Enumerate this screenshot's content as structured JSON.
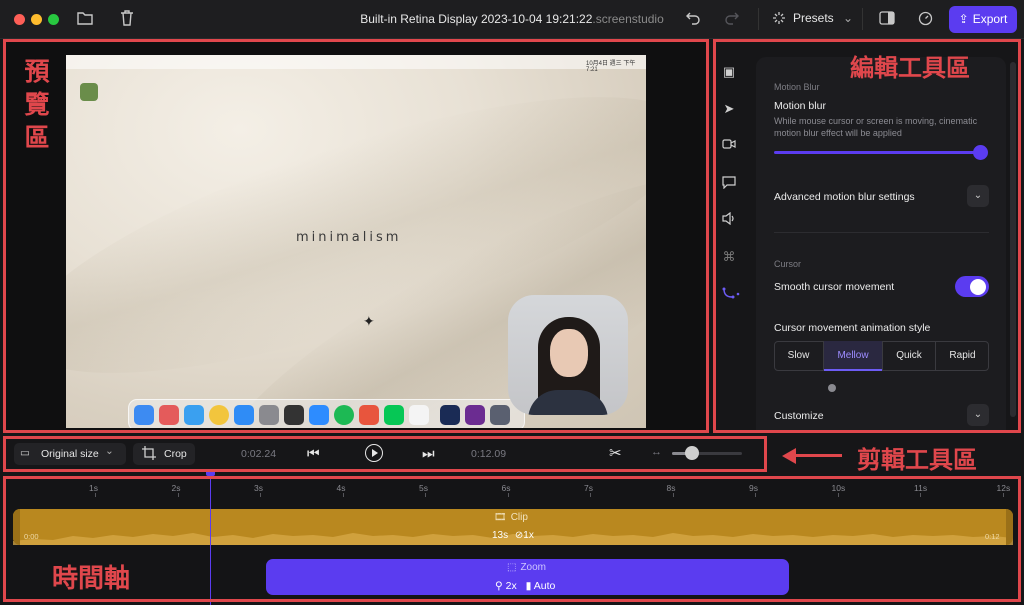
{
  "window": {
    "title": "Built-in Retina Display 2023-10-04 19:21:22",
    "title_ext": ".screenstudio",
    "presets_label": "Presets",
    "export_label": "Export"
  },
  "annotations": {
    "preview": "預覽區",
    "edit_tools": "編輯工具區",
    "cut_tools": "剪輯工具區",
    "timeline": "時間軸"
  },
  "preview": {
    "wallpaper_text": "minimalism",
    "menubar_clock": "10月4日 週三  下午7:21"
  },
  "panel": {
    "motion_blur_section": "Motion Blur",
    "motion_blur_label": "Motion blur",
    "motion_blur_desc": "While mouse cursor or screen is moving, cinematic motion blur effect will be applied",
    "motion_blur_value": 1.0,
    "advanced_label": "Advanced motion blur settings",
    "cursor_section": "Cursor",
    "smooth_cursor_label": "Smooth cursor movement",
    "smooth_cursor_on": true,
    "anim_style_label": "Cursor movement animation style",
    "anim_styles": [
      "Slow",
      "Mellow",
      "Quick",
      "Rapid"
    ],
    "anim_style_selected": "Mellow",
    "customize_label": "Customize"
  },
  "controls": {
    "size_label": "Original size",
    "crop_label": "Crop",
    "current_time": "0:02.24",
    "total_time": "0:12.09",
    "zoom_level": 0.3
  },
  "timeline": {
    "ticks": [
      "1s",
      "2s",
      "3s",
      "4s",
      "5s",
      "6s",
      "7s",
      "8s",
      "9s",
      "10s",
      "11s",
      "12s"
    ],
    "clip_label": "Clip",
    "clip_start": "0:00",
    "clip_end": "0:12",
    "clip_duration": "13s",
    "clip_speed": "1x",
    "zoom_label": "Zoom",
    "zoom_amount": "2x",
    "zoom_mode": "Auto"
  },
  "colors": {
    "accent": "#5b3cf0",
    "clip": "#b9881f",
    "annotation": "#e0474c"
  }
}
